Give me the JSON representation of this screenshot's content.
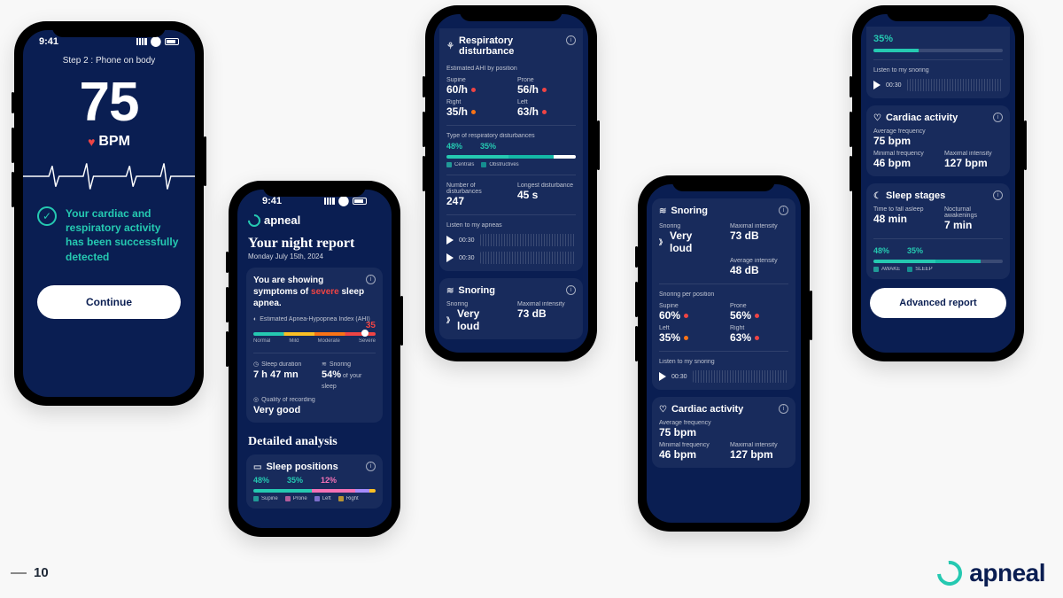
{
  "page_number": "10",
  "brand": "apneal",
  "status": {
    "time": "9:41"
  },
  "p1": {
    "step": "Step 2 : Phone on body",
    "bpm": "75",
    "bpm_label": "BPM",
    "confirm": "Your cardiac and respiratory activity has been successfully detected",
    "continue": "Continue"
  },
  "p2": {
    "title": "Your night report",
    "date": "Monday July 15th, 2024",
    "symptom_pre": "You are showing symptoms of ",
    "symptom_sev": "severe",
    "symptom_post": " sleep apnea.",
    "ahi_label": "Estimated Apnea-Hypopnea Index (AHI)",
    "ahi_value": "35",
    "ticks": [
      "Normal",
      "Mild",
      "Moderate",
      "Severe"
    ],
    "duration_label": "Sleep duration",
    "duration": "7 h 47 mn",
    "snoring_label": "Snoring",
    "snoring": "54%",
    "snoring_sub": " of your sleep",
    "quality_label": "Quality of recording",
    "quality": "Very good",
    "detailed": "Detailed analysis",
    "positions_title": "Sleep positions",
    "pos": [
      {
        "label": "Supine",
        "pct": "48%",
        "color": "#25c9b1"
      },
      {
        "label": "Prone",
        "pct": "35%",
        "color": "#f472b6"
      },
      {
        "label": "Left",
        "pct": "12%",
        "color": "#a78bfa"
      },
      {
        "label": "Right",
        "pct": "",
        "color": "#fbbf24"
      }
    ],
    "pct_row": [
      "48%",
      "35%",
      "12%"
    ]
  },
  "p3": {
    "title": "Respiratory disturbance",
    "ahi_pos_label": "Estimated AHI by position",
    "ahi_pos": [
      {
        "lbl": "Supine",
        "val": "60/h",
        "dot": "r"
      },
      {
        "lbl": "Prone",
        "val": "56/h",
        "dot": "r"
      },
      {
        "lbl": "Right",
        "val": "35/h",
        "dot": "o"
      },
      {
        "lbl": "Left",
        "val": "63/h",
        "dot": "r"
      }
    ],
    "type_label": "Type of respiratory disturbances",
    "type_pct": [
      "48%",
      "35%"
    ],
    "type_legend": [
      {
        "label": "Centrals",
        "color": "#25c9b1"
      },
      {
        "label": "Obstructives",
        "color": "#14b8a6"
      }
    ],
    "num_label": "Number of disturbances",
    "num": "247",
    "longest_label": "Longest disturbance",
    "longest": "45 s",
    "listen": "Listen to my apneas",
    "ts": [
      "00:30",
      "00:30"
    ],
    "snoring_title": "Snoring",
    "snoring_label": "Snoring",
    "snoring_val": "Very loud",
    "max_int_label": "Maximal intensity",
    "max_int": "73 dB"
  },
  "p4": {
    "title": "Snoring",
    "snoring_label": "Snoring",
    "snoring_val": "Very loud",
    "max_int_label": "Maximal intensity",
    "max_int": "73 dB",
    "avg_int_label": "Average intensity",
    "avg_int": "48 dB",
    "pos_label": "Snoring per position",
    "pos": [
      {
        "lbl": "Supine",
        "val": "60%",
        "dot": "r"
      },
      {
        "lbl": "Prone",
        "val": "56%",
        "dot": "r"
      },
      {
        "lbl": "Left",
        "val": "35%",
        "dot": "o"
      },
      {
        "lbl": "Right",
        "val": "63%",
        "dot": "r"
      }
    ],
    "listen": "Listen to my snoring",
    "ts": "00:30",
    "cardiac_title": "Cardiac activity",
    "avg_freq_label": "Average frequency",
    "avg_freq": "75 bpm",
    "min_freq_label": "Minimal frequency",
    "min_freq": "46 bpm",
    "card_max_label": "Maximal intensity",
    "card_max": "127 bpm"
  },
  "p5": {
    "top_pct": "35%",
    "listen": "Listen to my snoring",
    "ts": "00:30",
    "cardiac_title": "Cardiac activity",
    "avg_freq_label": "Average frequency",
    "avg_freq": "75 bpm",
    "min_freq_label": "Minimal frequency",
    "min_freq": "46 bpm",
    "card_max_label": "Maximal intensity",
    "card_max": "127 bpm",
    "stages_title": "Sleep stages",
    "fall_label": "Time to fall asleep",
    "fall": "48 min",
    "wake_label": "Nocturnal awakenings",
    "wake": "7 min",
    "stage_pct": [
      "48%",
      "35%"
    ],
    "stage_legend": [
      {
        "label": "AWAKE",
        "color": "#25c9b1"
      },
      {
        "label": "SLEEP",
        "color": "#14b8a6"
      }
    ],
    "advanced": "Advanced report"
  }
}
